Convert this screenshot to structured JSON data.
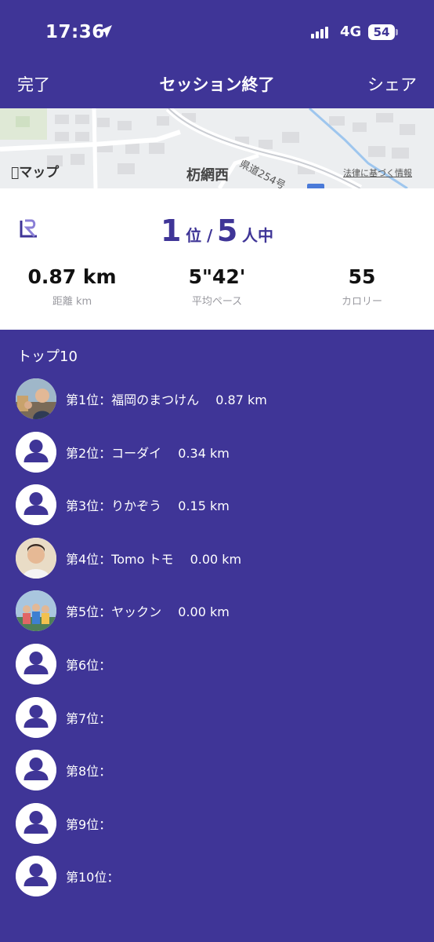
{
  "status_bar": {
    "time": "17:36",
    "network": "4G",
    "battery": "54"
  },
  "nav": {
    "done_label": "完了",
    "title": "セッション終了",
    "share_label": "シェア"
  },
  "map": {
    "logo_text": "マップ",
    "place_label": "杤網西",
    "road_label": "県道254号",
    "legal_label": "法律に基づく情報"
  },
  "summary": {
    "rank": "1",
    "rank_suffix": "位 /",
    "participants": "5",
    "participants_suffix": "人中",
    "stats": [
      {
        "value": "0.87 km",
        "label": "距離 km"
      },
      {
        "value": "5\"42'",
        "label": "平均ペース"
      },
      {
        "value": "55",
        "label": "カロリー"
      }
    ]
  },
  "leaderboard": {
    "title": "トップ10",
    "entries": [
      {
        "text": "第1位：福岡のまつけん　 0.87 km",
        "avatar": "photo-avatar"
      },
      {
        "text": "第2位：コーダイ　 0.34 km",
        "avatar": "default-user-icon"
      },
      {
        "text": "第3位：りかぞう　 0.15 km",
        "avatar": "default-user-icon"
      },
      {
        "text": "第4位：Tomo トモ　 0.00 km",
        "avatar": "photo-avatar"
      },
      {
        "text": "第5位：ヤックン　 0.00 km",
        "avatar": "photo-avatar"
      },
      {
        "text": "第6位：",
        "avatar": "default-user-icon"
      },
      {
        "text": "第7位：",
        "avatar": "default-user-icon"
      },
      {
        "text": "第8位：",
        "avatar": "default-user-icon"
      },
      {
        "text": "第9位：",
        "avatar": "default-user-icon"
      },
      {
        "text": "第10位：",
        "avatar": "default-user-icon"
      }
    ]
  },
  "colors": {
    "brand_purple": "#3f3597",
    "card_white": "#ffffff",
    "label_gray": "#9a9aa0"
  }
}
